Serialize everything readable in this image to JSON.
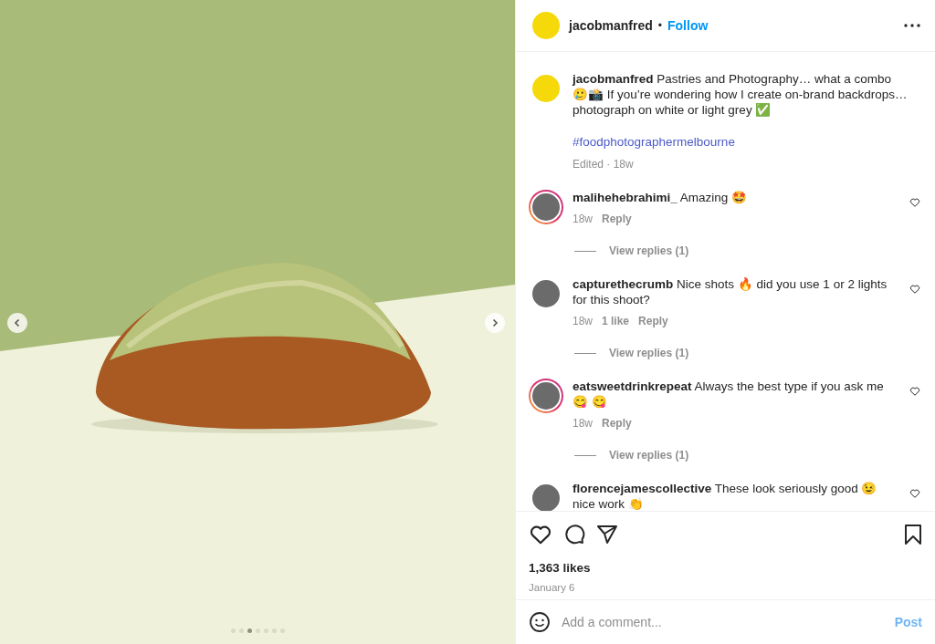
{
  "photo": {
    "slides": [
      {
        "selected": false
      },
      {
        "selected": false
      },
      {
        "selected": true
      },
      {
        "selected": false
      },
      {
        "selected": false
      },
      {
        "selected": false
      },
      {
        "selected": false
      }
    ]
  },
  "header": {
    "username": "jacobmanfred",
    "separator": "•",
    "follow": "Follow"
  },
  "caption": {
    "username": "jacobmanfred",
    "text": "Pastries and Photography… what a combo 🥲📸 If you’re wondering how I create on-brand backdrops… photograph on white or light grey ✅",
    "hashtag": "#foodphotographermelbourne",
    "meta": "Edited · 18w"
  },
  "comments": [
    {
      "username": "malihehebrahimi_",
      "text": "Amazing 🤩",
      "story_ring": true,
      "time": "18w",
      "reply": "Reply",
      "view_replies": "View replies (1)"
    },
    {
      "username": "capturethecrumb",
      "text": "Nice shots 🔥 did you use 1 or 2 lights for this shoot?",
      "story_ring": false,
      "time": "18w",
      "likes": "1 like",
      "reply": "Reply",
      "view_replies": "View replies (1)"
    },
    {
      "username": "eatsweetdrinkrepeat",
      "text": "Always the best type if you ask me 😋 😋",
      "story_ring": true,
      "time": "18w",
      "reply": "Reply",
      "view_replies": "View replies (1)"
    },
    {
      "username": "florencejamescollective",
      "text": "These look seriously good 😉 nice work 👏",
      "story_ring": false
    }
  ],
  "actions": {
    "liked": false,
    "saved": false,
    "likes": "1,363 likes",
    "date": "January 6"
  },
  "composer": {
    "placeholder": "Add a comment...",
    "post": "Post",
    "disabled": true
  }
}
